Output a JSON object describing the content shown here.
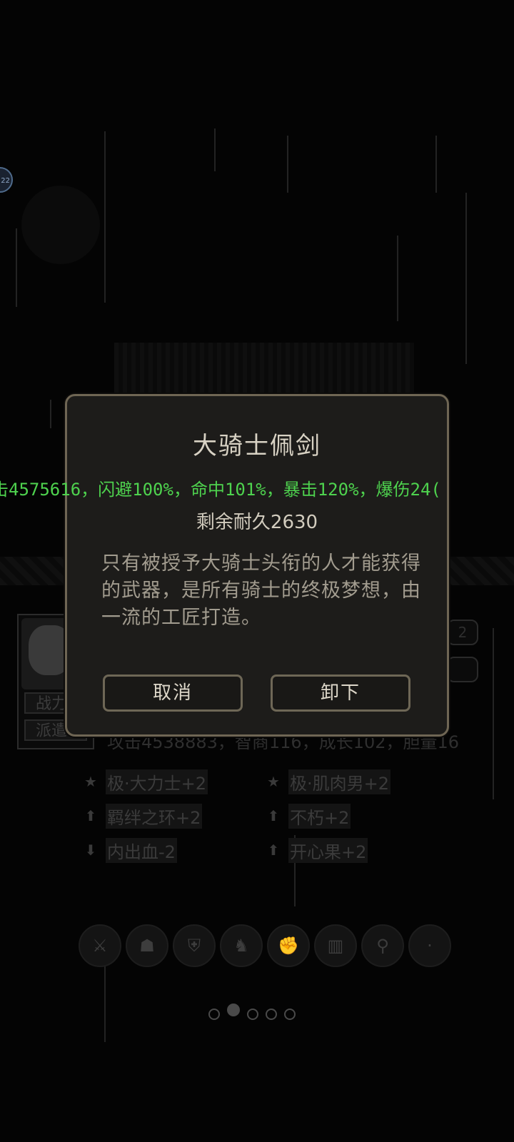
{
  "modal": {
    "title": "大骑士佩剑",
    "durability": "剩余耐久2630",
    "description": "只有被授予大骑士头衔的人才能获得的武器，是所有骑士的终极梦想，由一流的工匠打造。",
    "cancel_label": "取消",
    "unequip_label": "卸下"
  },
  "ticker": {
    "text": "击4575616，闪避100%，命中101%，暴击120%，爆伤24("
  },
  "top_avatar": {
    "badge": "22"
  },
  "background": {
    "card_buttons": [
      "战力",
      "派遣"
    ],
    "stats_line": "攻击4538883，智商116，成长102，胆量16",
    "bar_values": [
      "2"
    ],
    "traits": [
      {
        "icon": "star-icon",
        "text": "极·大力士+2"
      },
      {
        "icon": "star-icon",
        "text": "极·肌肉男+2"
      },
      {
        "icon": "arrow-up-icon",
        "text": "羁绊之环+2"
      },
      {
        "icon": "arrow-up-icon",
        "text": "不朽+2"
      },
      {
        "icon": "arrow-down-icon",
        "text": "内出血-2"
      },
      {
        "icon": "arrow-up-icon",
        "text": "开心果+2"
      }
    ],
    "equipment_slots": [
      "sword-icon",
      "helmet-icon",
      "armor-icon",
      "boots-icon",
      "gauntlet-icon",
      "leg-armor-icon",
      "amulet-icon",
      "empty-slot-icon"
    ],
    "page_dots": {
      "count": 5,
      "active_index": 1
    }
  }
}
